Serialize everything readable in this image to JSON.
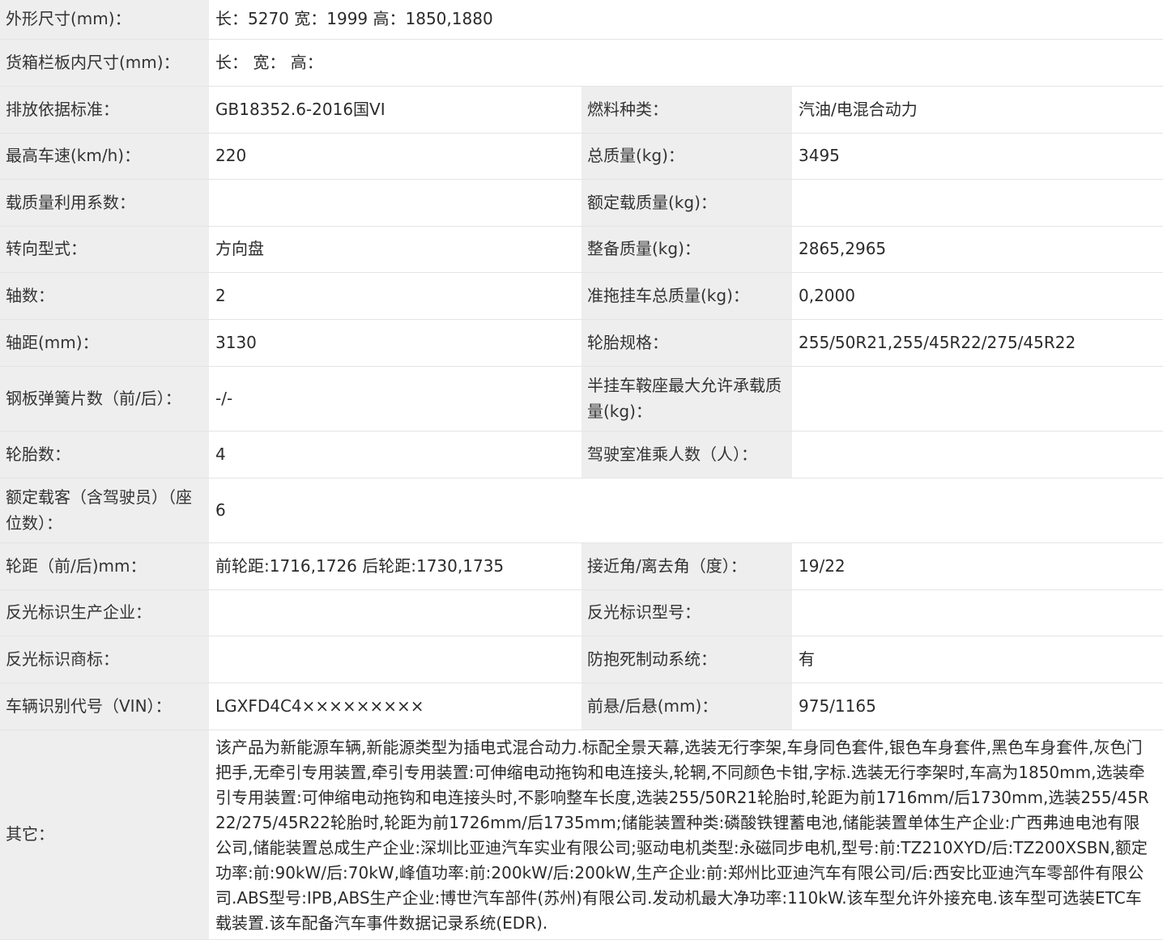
{
  "rows": [
    {
      "label": "外形尺寸(mm)：",
      "value": "长：5270 宽：1999 高：1850,1880"
    },
    {
      "label": "货箱栏板内尺寸(mm)：",
      "value": "长： 宽： 高："
    },
    {
      "label": "排放依据标准：",
      "value": "GB18352.6-2016国VI",
      "label2": "燃料种类：",
      "value2": "汽油/电混合动力"
    },
    {
      "label": "最高车速(km/h)：",
      "value": "220",
      "label2": "总质量(kg)：",
      "value2": "3495"
    },
    {
      "label": "载质量利用系数：",
      "value": "",
      "label2": "额定载质量(kg)：",
      "value2": ""
    },
    {
      "label": "转向型式：",
      "value": "方向盘",
      "label2": "整备质量(kg)：",
      "value2": "2865,2965"
    },
    {
      "label": "轴数：",
      "value": "2",
      "label2": "准拖挂车总质量(kg)：",
      "value2": "0,2000"
    },
    {
      "label": "轴距(mm)：",
      "value": "3130",
      "label2": "轮胎规格：",
      "value2": "255/50R21,255/45R22/275/45R22"
    },
    {
      "label": "钢板弹簧片数（前/后）：",
      "value": "-/-",
      "label2": "半挂车鞍座最大允许承载质量(kg)：",
      "value2": ""
    },
    {
      "label": "轮胎数：",
      "value": "4",
      "label2": "驾驶室准乘人数（人）：",
      "value2": ""
    },
    {
      "label": "额定载客（含驾驶员）（座位数）：",
      "value": "6"
    },
    {
      "label": "轮距（前/后)mm：",
      "value": "前轮距:1716,1726 后轮距:1730,1735",
      "label2": "接近角/离去角（度）：",
      "value2": "19/22"
    },
    {
      "label": "反光标识生产企业：",
      "value": "",
      "label2": "反光标识型号：",
      "value2": ""
    },
    {
      "label": "反光标识商标：",
      "value": "",
      "label2": "防抱死制动系统：",
      "value2": "有"
    },
    {
      "label": "车辆识别代号（VIN）：",
      "value": "LGXFD4C4×××××××××",
      "label2": "前悬/后悬(mm)：",
      "value2": "975/1165"
    }
  ],
  "notes": {
    "label": "其它：",
    "text": "该产品为新能源车辆,新能源类型为插电式混合动力.标配全景天幕,选装无行李架,车身同色套件,银色车身套件,黑色车身套件,灰色门把手,无牵引专用装置,牵引专用装置:可伸缩电动拖钩和电连接头,轮辋,不同颜色卡钳,字标.选装无行李架时,车高为1850mm,选装牵引专用装置:可伸缩电动拖钩和电连接头时,不影响整车长度,选装255/50R21轮胎时,轮距为前1716mm/后1730mm,选装255/45R22/275/45R22轮胎时,轮距为前1726mm/后1735mm;储能装置种类:磷酸铁锂蓄电池,储能装置单体生产企业:广西弗迪电池有限公司,储能装置总成生产企业:深圳比亚迪汽车实业有限公司;驱动电机类型:永磁同步电机,型号:前:TZ210XYD/后:TZ200XSBN,额定功率:前:90kW/后:70kW,峰值功率:前:200kW/后:200kW,生产企业:前:郑州比亚迪汽车有限公司/后:西安比亚迪汽车零部件有限公司.ABS型号:IPB,ABS生产企业:博世汽车部件(苏州)有限公司.发动机最大净功率:110kW.该车型允许外接充电.该车型可选装ETC车载装置.该车配备汽车事件数据记录系统(EDR)."
  }
}
